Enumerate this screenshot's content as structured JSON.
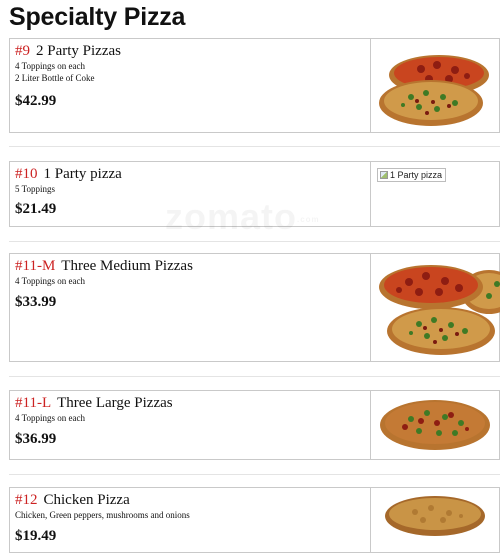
{
  "page": {
    "title": "Specialty Pizza",
    "watermark": "zomato",
    "watermark_suffix": ".com"
  },
  "items": [
    {
      "number": "#9",
      "name": "2 Party Pizzas",
      "desc1": "4 Toppings on each",
      "desc2": "2 Liter Bottle of Coke",
      "price": "$42.99"
    },
    {
      "number": "#10",
      "name": "1 Party pizza",
      "desc1": "5 Toppings",
      "price": "$21.49",
      "image_alt": "1 Party pizza"
    },
    {
      "number": "#11-M",
      "name": "Three Medium Pizzas",
      "desc1": "4 Toppings on each",
      "price": "$33.99"
    },
    {
      "number": "#11-L",
      "name": "Three Large Pizzas",
      "desc1": "4 Toppings on each",
      "price": "$36.99"
    },
    {
      "number": "#12",
      "name": "Chicken Pizza",
      "desc1": "Chicken, Green peppers, mushrooms and onions",
      "price": "$19.49"
    }
  ],
  "colors": {
    "item_number": "#cc2222",
    "border": "#c9c9c9"
  },
  "icons": {
    "broken_image": "broken-image-icon"
  }
}
